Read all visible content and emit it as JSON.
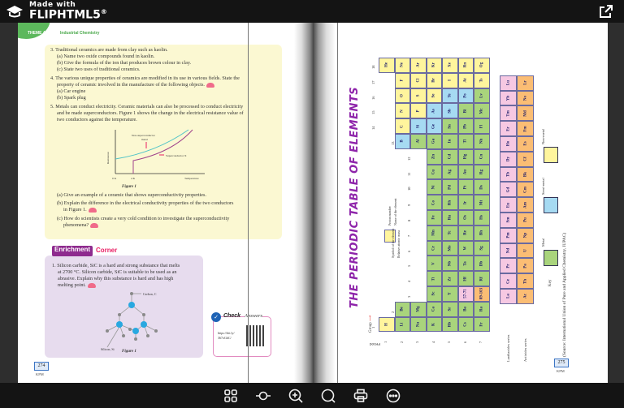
{
  "app": {
    "made_with": "Made with",
    "brand": "FLIPHTML5",
    "reg": "®"
  },
  "toolbar": {
    "icons": [
      "thumbnails-icon",
      "fit-page-icon",
      "zoom-in-icon",
      "search-icon",
      "print-icon",
      "more-icon"
    ]
  },
  "left_page": {
    "theme": "THEME 4",
    "theme_title": "Industrial Chemistry",
    "q3": "3. Traditional ceramics are made from clay such as kaolin.",
    "q3a": "(a) Name two oxide compounds found in kaolin.",
    "q3b": "(b) Give the formula of the ion that produces brown colour in clay.",
    "q3c": "(c) State two uses of traditional ceramics.",
    "q4": "4. The various unique properties of ceramics are modified in its use in various fields. State the",
    "q4_2": "property of ceramic involved in the manufacture of the following objects.",
    "q4a": "(a) Car engine",
    "q4b": "(b) Spark plug",
    "q5": "5. Metals can conduct electricity. Ceramic materials can also be processed to conduct electricity",
    "q5_2": "and be made superconductors. Figure 1 shows the change in the electrical resistance value of",
    "q5_3": "two conductors against the temperature.",
    "graph": {
      "ylabel": "Resistance",
      "xlabel": "Temperature",
      "x0": "0 K",
      "x1": "4 K",
      "curve1": "Non-superconductor",
      "curve1b": "metal",
      "curve2": "Superconductor X",
      "caption": "Figure 1"
    },
    "q5a": "(a) Give an example of a ceramic that shows superconductivity properties.",
    "q5b": "(b) Explain the difference in the electrical conductivity properties of the two conductors",
    "q5b_2": "in Figure 1.",
    "q5c": "(c) How do scientists create a very cold condition to investigate the superconductivity",
    "q5c_2": "phenomena?",
    "enrichment": "Enrichment",
    "corner": "Corner",
    "e1": "1. Silicon carbide, SiC is a hard and strong substance that melts",
    "e1_2": "at 2700 °C. Silicon carbide, SiC is suitable to be used as an",
    "e1_3": "abrasive. Explain why this substance is hard and has high",
    "e1_4": "melting point.",
    "carbon": "Carbon, C",
    "silicon": "Silicon, Si",
    "fig_caption": "Figure 1",
    "check": "Check",
    "answers": "Answers",
    "url": "https://bit.ly/",
    "url2": "367oGbC/",
    "page_number": "274",
    "kpm": "KPM"
  },
  "right_page": {
    "title": "THE PERIODIC TABLE OF ELEMENTS",
    "group_label": "Group",
    "period_label": "Period",
    "legend_proton": "Proton number",
    "legend_name": "Name of the element",
    "legend_symbol": "Symbol of the element",
    "legend_mass": "Relative atomic mass",
    "groups": [
      "1",
      "2",
      "3",
      "4",
      "5",
      "6",
      "7",
      "8",
      "9",
      "10",
      "11",
      "12",
      "13",
      "14",
      "15",
      "16",
      "17",
      "18"
    ],
    "periods": [
      "1",
      "2",
      "3",
      "4",
      "5",
      "6",
      "7"
    ],
    "table": [
      [
        "H",
        "",
        "",
        "",
        "",
        "",
        "",
        "",
        "",
        "",
        "",
        "",
        "",
        "",
        "",
        "",
        "",
        "He"
      ],
      [
        "Li",
        "Be",
        "",
        "",
        "",
        "",
        "",
        "",
        "",
        "",
        "",
        "",
        "B",
        "C",
        "N",
        "O",
        "F",
        "Ne"
      ],
      [
        "Na",
        "Mg",
        "",
        "",
        "",
        "",
        "",
        "",
        "",
        "",
        "",
        "",
        "Al",
        "Si",
        "P",
        "S",
        "Cl",
        "Ar"
      ],
      [
        "K",
        "Ca",
        "Sc",
        "Ti",
        "V",
        "Cr",
        "Mn",
        "Fe",
        "Co",
        "Ni",
        "Cu",
        "Zn",
        "Ga",
        "Ge",
        "As",
        "Se",
        "Br",
        "Kr"
      ],
      [
        "Rb",
        "Sr",
        "Y",
        "Zr",
        "Nb",
        "Mo",
        "Tc",
        "Ru",
        "Rh",
        "Pd",
        "Ag",
        "Cd",
        "In",
        "Sn",
        "Sb",
        "Te",
        "I",
        "Xe"
      ],
      [
        "Cs",
        "Ba",
        "57-71",
        "Hf",
        "Ta",
        "W",
        "Re",
        "Os",
        "Ir",
        "Pt",
        "Au",
        "Hg",
        "Tl",
        "Pb",
        "Bi",
        "Po",
        "At",
        "Rn"
      ],
      [
        "Fr",
        "Ra",
        "89-103",
        "Rf",
        "Db",
        "Sg",
        "Bh",
        "Hs",
        "Mt",
        "Ds",
        "Rg",
        "Cn",
        "Nh",
        "Fl",
        "Mc",
        "Lv",
        "Ts",
        "Og"
      ]
    ],
    "nonmetals": [
      "H",
      "He",
      "C",
      "N",
      "O",
      "F",
      "Ne",
      "P",
      "S",
      "Cl",
      "Ar",
      "Se",
      "Br",
      "Kr",
      "I",
      "Xe",
      "At",
      "Rn",
      "Ts",
      "Og"
    ],
    "semimetals": [
      "B",
      "Si",
      "Ge",
      "As",
      "Sb",
      "Te",
      "Po"
    ],
    "lanthanides": [
      "La",
      "Ce",
      "Pr",
      "Nd",
      "Pm",
      "Sm",
      "Eu",
      "Gd",
      "Tb",
      "Dy",
      "Ho",
      "Er",
      "Tm",
      "Yb",
      "Lu"
    ],
    "actinides": [
      "Ac",
      "Th",
      "Pa",
      "U",
      "Np",
      "Pu",
      "Am",
      "Cm",
      "Bk",
      "Cf",
      "Es",
      "Fm",
      "Md",
      "No",
      "Lr"
    ],
    "lanthanides_label": "Lanthanides series",
    "actinides_label": "Actinides series",
    "key_label": "Key",
    "key_metal": "Metal",
    "key_semimetal": "Semi-metal",
    "key_nonmetal": "Non-metal",
    "source": "(Source: International Union of Pure and Applied Chemistry, IUPAC)",
    "page_number": "275",
    "kpm": "KPM",
    "colors": {
      "metal": "#a9d47c",
      "semimetal": "#a6daf2",
      "nonmetal": "#fff59d",
      "lanthanide": "#f6c8e2",
      "actinide": "#fbbd74",
      "title": "#8e24aa"
    }
  }
}
